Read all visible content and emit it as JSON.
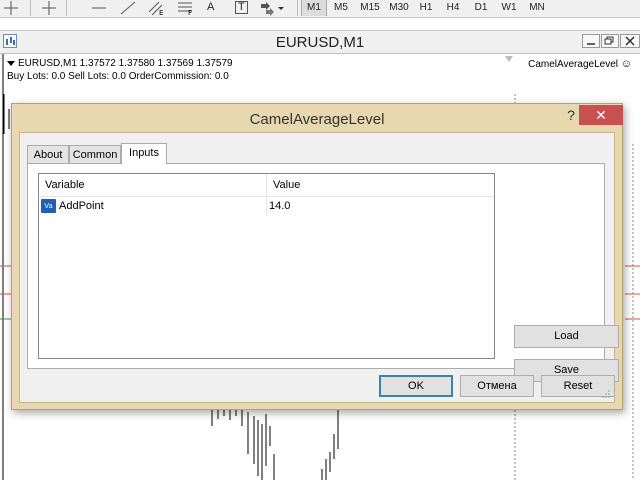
{
  "toolbar": {
    "letters": [
      "A",
      "T"
    ],
    "timeframes": [
      "M1",
      "M5",
      "M15",
      "M30",
      "H1",
      "H4",
      "D1",
      "W1",
      "MN"
    ],
    "active_timeframe": "M1"
  },
  "chart_window": {
    "title": "EURUSD,M1",
    "info_line": "EURUSD,M1  1.37572 1.37580 1.37569 1.37579",
    "orders_line": "Buy Lots: 0.0 Sell Lots: 0.0 OrderCommission: 0.0",
    "indicator_label": "CamelAverageLevel"
  },
  "dialog": {
    "title": "CamelAverageLevel",
    "help_label": "?",
    "close_label": "✕",
    "tabs": [
      {
        "label": "About",
        "active": false
      },
      {
        "label": "Common",
        "active": false
      },
      {
        "label": "Inputs",
        "active": true
      }
    ],
    "table": {
      "columns": [
        "Variable",
        "Value"
      ],
      "rows": [
        {
          "icon": "Va",
          "variable": "AddPoint",
          "value": "14.0"
        }
      ]
    },
    "load_label": "Load",
    "save_label": "Save",
    "ok_label": "OK",
    "cancel_label": "Отмена",
    "reset_label": "Reset"
  },
  "colors": {
    "dialog_frame": "#e8d8b0",
    "close_button": "#c75050",
    "default_button_border": "#3c7fb1",
    "level_line": "#d05a3c",
    "level_line_green": "#3a9a3a"
  }
}
